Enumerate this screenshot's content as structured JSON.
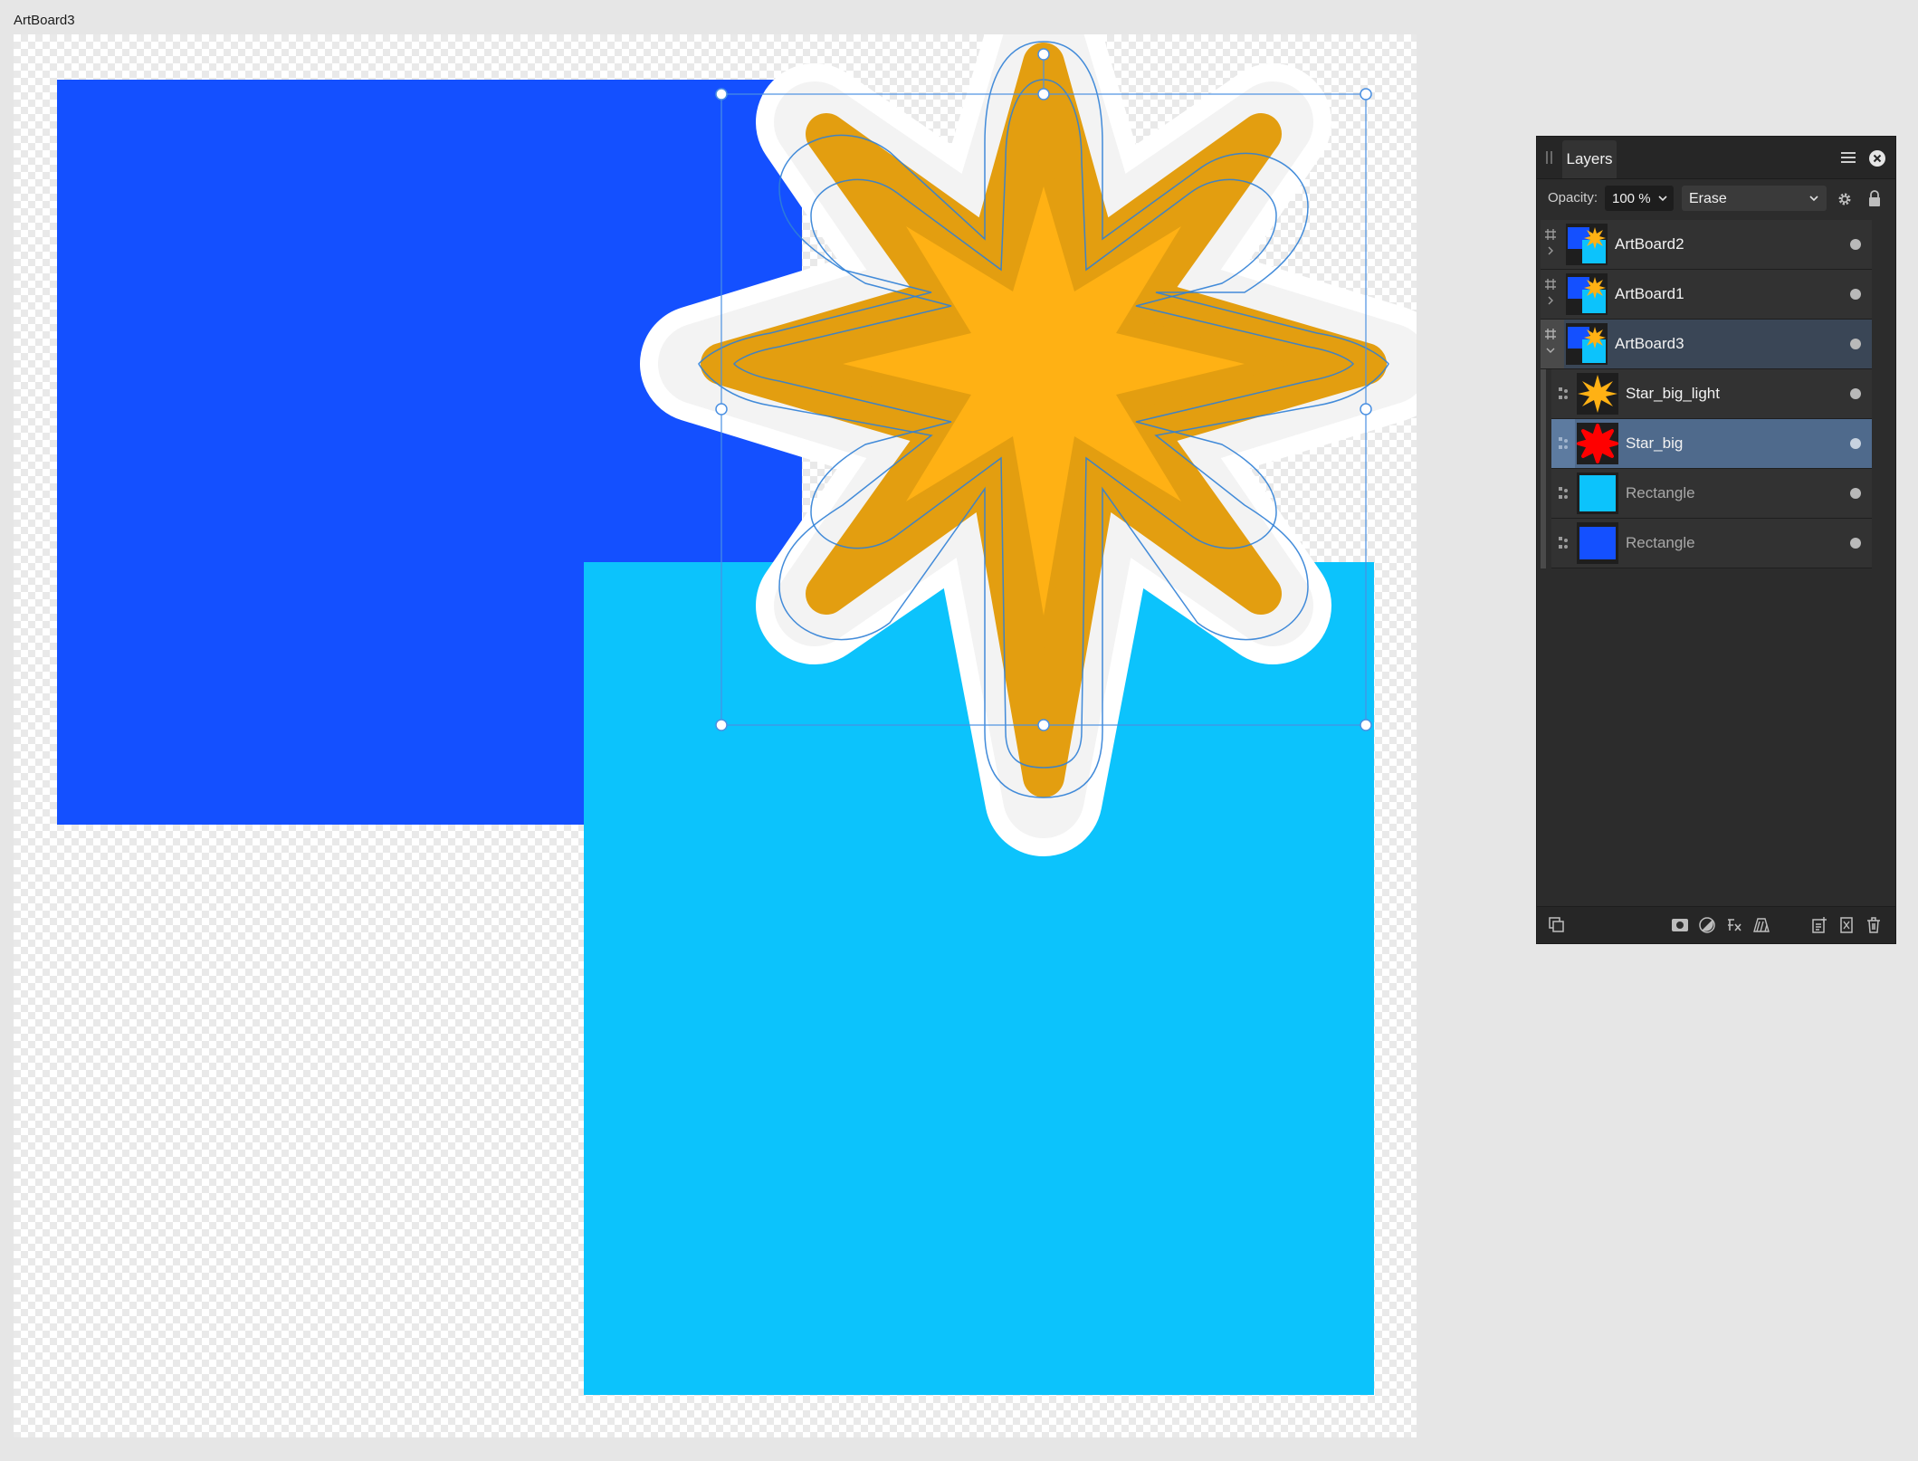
{
  "document": {
    "artboard_title": "ArtBoard3"
  },
  "colors": {
    "blue_rect": "#1450ff",
    "cyan_rect": "#0cc3fc",
    "star_outer": "#e39e10",
    "star_inner": "#ffb114",
    "selection": "#2f7fd6",
    "panel_bg": "#2c2c2c",
    "selected_row": "#4f6a8c"
  },
  "layers_panel": {
    "tab_label": "Layers",
    "menu_icon": "hamburger-menu-icon",
    "close_icon": "close-circle-icon",
    "opacity_label": "Opacity:",
    "opacity_value": "100 %",
    "blend_mode": "Erase",
    "layers": [
      {
        "name": "ArtBoard2",
        "kind": "artboard",
        "expanded": false,
        "selected": false
      },
      {
        "name": "ArtBoard1",
        "kind": "artboard",
        "expanded": false,
        "selected": false
      },
      {
        "name": "ArtBoard3",
        "kind": "artboard",
        "expanded": true,
        "selected": false
      },
      {
        "name": "Star_big_light",
        "kind": "curve",
        "selected": false,
        "thumb": "star-orange"
      },
      {
        "name": "Star_big",
        "kind": "curve",
        "selected": true,
        "thumb": "star-red"
      },
      {
        "name": "Rectangle",
        "kind": "rectangle",
        "selected": false,
        "thumb": "rect-cyan",
        "dim": true
      },
      {
        "name": "Rectangle",
        "kind": "rectangle",
        "selected": false,
        "thumb": "rect-blue",
        "dim": true
      }
    ],
    "footer_icons": [
      "arrange-layers-icon",
      "mask-icon",
      "adjustment-icon",
      "fx-icon",
      "hatch-icon",
      "add-layer-icon",
      "group-icon",
      "trash-icon"
    ]
  }
}
